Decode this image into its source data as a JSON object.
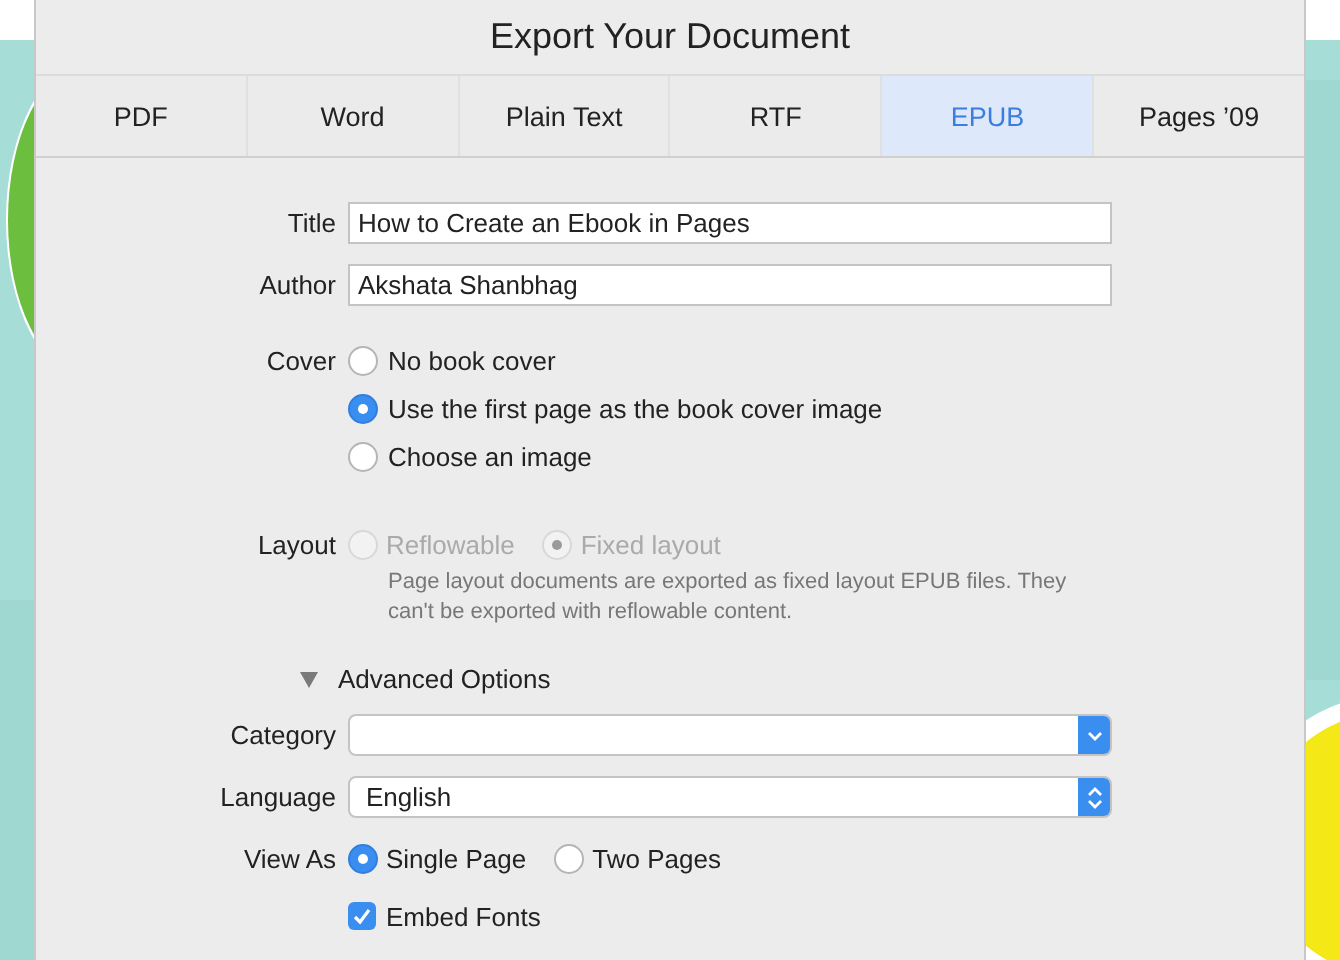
{
  "window": {
    "title": "Export Your Document"
  },
  "tabs": [
    {
      "label": "PDF",
      "selected": false
    },
    {
      "label": "Word",
      "selected": false
    },
    {
      "label": "Plain Text",
      "selected": false
    },
    {
      "label": "RTF",
      "selected": false
    },
    {
      "label": "EPUB",
      "selected": true
    },
    {
      "label": "Pages ’09",
      "selected": false
    }
  ],
  "fields": [
    {
      "label": "Title",
      "value": "How to Create an Ebook in Pages"
    },
    {
      "label": "Author",
      "value": "Akshata Shanbhag"
    }
  ],
  "cover": {
    "label": "Cover",
    "options": [
      {
        "label": "No book cover",
        "selected": false
      },
      {
        "label": "Use the first page as the book cover image",
        "selected": true
      },
      {
        "label": "Choose an image",
        "selected": false
      }
    ]
  },
  "layout": {
    "label": "Layout",
    "disabled": true,
    "options": [
      {
        "label": "Reflowable",
        "selected": false
      },
      {
        "label": "Fixed layout",
        "selected": true
      }
    ],
    "note": "Page layout documents are exported as fixed layout EPUB files. They can't be exported with reflowable content."
  },
  "advanced": {
    "label": "Advanced Options",
    "expanded": true
  },
  "selects": [
    {
      "label": "Category",
      "kind": "pulldown"
    },
    {
      "label": "Language",
      "value": "English",
      "kind": "popup"
    }
  ],
  "view_as": {
    "label": "View As",
    "options": [
      {
        "label": "Single Page",
        "selected": true
      },
      {
        "label": "Two Pages",
        "selected": false
      }
    ]
  },
  "embed_fonts": {
    "label": "Embed Fonts",
    "checked": true
  }
}
